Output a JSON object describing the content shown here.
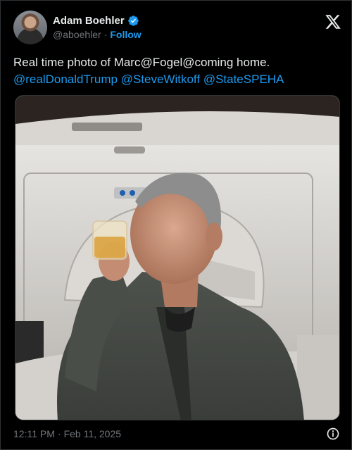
{
  "author": {
    "display_name": "Adam Boehler",
    "handle": "@aboehler",
    "separator": "·",
    "follow_label": "Follow"
  },
  "tweet": {
    "text_plain": "Real time photo of Marc@Fogel@coming home.",
    "mentions": [
      "@realDonaldTrump",
      "@SteveWitkoff",
      "@StateSPEHA"
    ]
  },
  "meta": {
    "time": "12:11 PM",
    "separator": "·",
    "date": "Feb 11, 2025"
  },
  "icons": {
    "verified": "verified-badge-icon",
    "x": "x-logo-icon",
    "info": "info-icon"
  },
  "colors": {
    "background": "#000000",
    "text": "#e7e9ea",
    "secondary": "#71767b",
    "accent": "#1d9bf0"
  }
}
